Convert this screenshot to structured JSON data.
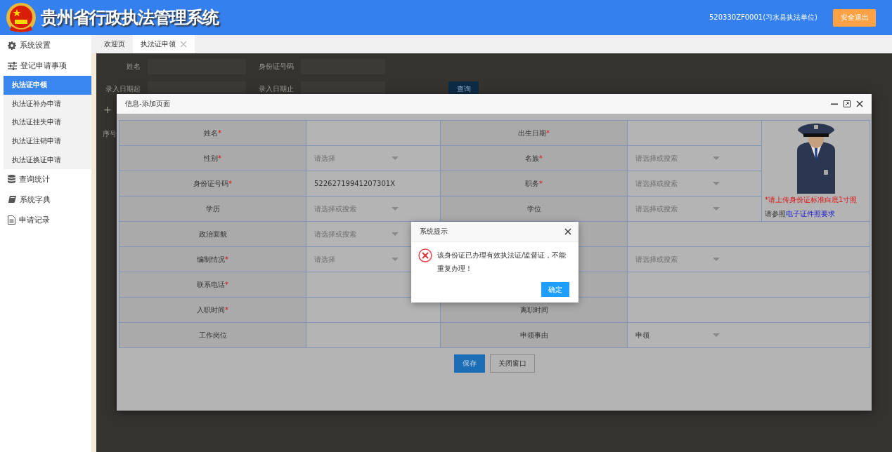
{
  "header": {
    "title": "贵州省行政执法管理系统",
    "user": "520330ZF0001(习水县执法单位)",
    "logout": "安全退出"
  },
  "sidebar": {
    "items": [
      {
        "label": "系统设置"
      },
      {
        "label": "登记申请事项",
        "children": [
          {
            "label": "执法证申领",
            "selected": true
          },
          {
            "label": "执法证补办申请",
            "selected": false
          },
          {
            "label": "执法证挂失申请",
            "selected": false
          },
          {
            "label": "执法证注销申请",
            "selected": false
          },
          {
            "label": "执法证换证申请",
            "selected": false
          }
        ]
      },
      {
        "label": "查询统计"
      },
      {
        "label": "系统字典"
      },
      {
        "label": "申请记录"
      }
    ]
  },
  "tabs": [
    {
      "label": "欢迎页",
      "selected": false,
      "closable": false
    },
    {
      "label": "执法证申领",
      "selected": true,
      "closable": true
    }
  ],
  "search_form": {
    "fields": [
      {
        "label": "姓名"
      },
      {
        "label": "身份证号码"
      },
      {
        "label": "录入日期起"
      },
      {
        "label": "录入日期止"
      }
    ],
    "query_button": "查询"
  },
  "toolbar": {
    "add": "+"
  },
  "table": {
    "columns": [
      "序号"
    ]
  },
  "modal": {
    "title": "信息-添加页面",
    "rows": [
      {
        "cells": [
          {
            "kind": "label",
            "text": "姓名",
            "mark": "*"
          },
          {
            "kind": "input"
          },
          {
            "kind": "label",
            "text": "出生日期",
            "mark": "*"
          },
          {
            "kind": "input"
          }
        ]
      },
      {
        "cells": [
          {
            "kind": "label",
            "text": "性别",
            "mark": "*"
          },
          {
            "kind": "select",
            "placeholder": "请选择"
          },
          {
            "kind": "label",
            "text": "名族",
            "mark": "*"
          },
          {
            "kind": "select",
            "placeholder": "请选择或搜索"
          }
        ]
      },
      {
        "cells": [
          {
            "kind": "label",
            "text": "身份证号码",
            "mark": "*"
          },
          {
            "kind": "input",
            "value": "52262719941207301X"
          },
          {
            "kind": "label",
            "text": "职务",
            "mark": "*"
          },
          {
            "kind": "select",
            "placeholder": "请选择或搜索"
          }
        ]
      },
      {
        "cells": [
          {
            "kind": "label",
            "text": "学历"
          },
          {
            "kind": "select",
            "placeholder": "请选择或搜索"
          },
          {
            "kind": "label",
            "text": "学位"
          },
          {
            "kind": "select",
            "placeholder": "请选择或搜索"
          }
        ]
      },
      {
        "cells": [
          {
            "kind": "label",
            "text": "政治面貌"
          },
          {
            "kind": "select",
            "placeholder": "请选择或搜索"
          },
          {
            "kind": "label"
          },
          {
            "kind": "input",
            "wide": true
          }
        ]
      },
      {
        "cells": [
          {
            "kind": "label",
            "text": "编制情况",
            "mark": "*"
          },
          {
            "kind": "select",
            "placeholder": "请选择"
          },
          {
            "kind": "label"
          },
          {
            "kind": "select",
            "placeholder": "请选择或搜索",
            "wide": true
          }
        ]
      },
      {
        "cells": [
          {
            "kind": "label",
            "text": "联系电话",
            "mark": "*"
          },
          {
            "kind": "input"
          },
          {
            "kind": "label"
          },
          {
            "kind": "input",
            "wide": true
          }
        ]
      },
      {
        "cells": [
          {
            "kind": "label",
            "text": "入职时间",
            "mark": "*"
          },
          {
            "kind": "input"
          },
          {
            "kind": "label",
            "text": "离职时间"
          },
          {
            "kind": "input",
            "wide": true
          }
        ]
      },
      {
        "cells": [
          {
            "kind": "label",
            "text": "工作岗位"
          },
          {
            "kind": "input"
          },
          {
            "kind": "label",
            "text": "申领事由"
          },
          {
            "kind": "select",
            "value": "申领",
            "wide": true
          }
        ]
      }
    ],
    "photo": {
      "note": "*请上传身份证标准白底1寸照",
      "hint": "请参照",
      "link": "电子证件照要求"
    },
    "buttons": [
      {
        "label": "保存",
        "kind": "primary"
      },
      {
        "label": "关闭窗口",
        "kind": "default"
      }
    ]
  },
  "dialog": {
    "title": "系统提示",
    "message": "该身份证已办理有效执法证/监督证，不能重复办理！",
    "confirm": "确定"
  }
}
